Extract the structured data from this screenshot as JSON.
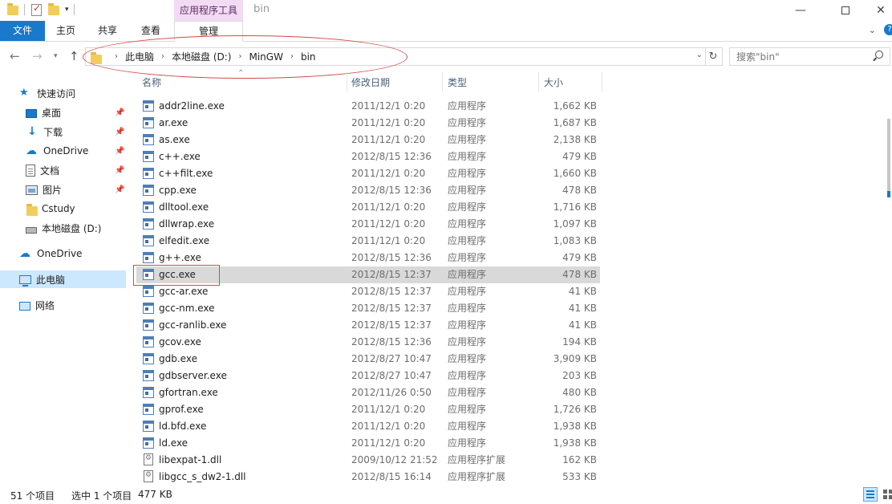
{
  "window": {
    "title": "bin",
    "context_tab_title": "应用程序工具"
  },
  "ribbon": {
    "tabs": [
      "文件",
      "主页",
      "共享",
      "查看",
      "管理"
    ]
  },
  "address": {
    "crumbs": [
      "此电脑",
      "本地磁盘 (D:)",
      "MinGW",
      "bin"
    ],
    "search_placeholder": "搜索\"bin\""
  },
  "sidebar": {
    "quick_access": "快速访问",
    "items": [
      {
        "label": "桌面",
        "icon": "desktop-icon",
        "pinned": true
      },
      {
        "label": "下载",
        "icon": "download-icon",
        "pinned": true
      },
      {
        "label": "OneDrive",
        "icon": "onedrive-icon",
        "pinned": true
      },
      {
        "label": "文档",
        "icon": "documents-icon",
        "pinned": true
      },
      {
        "label": "图片",
        "icon": "pictures-icon",
        "pinned": true
      },
      {
        "label": "Cstudy",
        "icon": "folder-icon",
        "pinned": false
      },
      {
        "label": "本地磁盘 (D:)",
        "icon": "drive-icon",
        "pinned": false
      }
    ],
    "onedrive": "OneDrive",
    "this_pc": "此电脑",
    "network": "网络"
  },
  "columns": {
    "name": "名称",
    "date": "修改日期",
    "type": "类型",
    "size": "大小"
  },
  "files": [
    {
      "name": "addr2line.exe",
      "date": "2011/12/1 0:20",
      "type": "应用程序",
      "size": "1,662 KB",
      "kind": "exe"
    },
    {
      "name": "ar.exe",
      "date": "2011/12/1 0:20",
      "type": "应用程序",
      "size": "1,687 KB",
      "kind": "exe"
    },
    {
      "name": "as.exe",
      "date": "2011/12/1 0:20",
      "type": "应用程序",
      "size": "2,138 KB",
      "kind": "exe"
    },
    {
      "name": "c++.exe",
      "date": "2012/8/15 12:36",
      "type": "应用程序",
      "size": "479 KB",
      "kind": "exe"
    },
    {
      "name": "c++filt.exe",
      "date": "2011/12/1 0:20",
      "type": "应用程序",
      "size": "1,660 KB",
      "kind": "exe"
    },
    {
      "name": "cpp.exe",
      "date": "2012/8/15 12:36",
      "type": "应用程序",
      "size": "478 KB",
      "kind": "exe"
    },
    {
      "name": "dlltool.exe",
      "date": "2011/12/1 0:20",
      "type": "应用程序",
      "size": "1,716 KB",
      "kind": "exe"
    },
    {
      "name": "dllwrap.exe",
      "date": "2011/12/1 0:20",
      "type": "应用程序",
      "size": "1,097 KB",
      "kind": "exe"
    },
    {
      "name": "elfedit.exe",
      "date": "2011/12/1 0:20",
      "type": "应用程序",
      "size": "1,083 KB",
      "kind": "exe"
    },
    {
      "name": "g++.exe",
      "date": "2012/8/15 12:36",
      "type": "应用程序",
      "size": "479 KB",
      "kind": "exe"
    },
    {
      "name": "gcc.exe",
      "date": "2012/8/15 12:37",
      "type": "应用程序",
      "size": "478 KB",
      "kind": "exe",
      "selected": true
    },
    {
      "name": "gcc-ar.exe",
      "date": "2012/8/15 12:37",
      "type": "应用程序",
      "size": "41 KB",
      "kind": "exe"
    },
    {
      "name": "gcc-nm.exe",
      "date": "2012/8/15 12:37",
      "type": "应用程序",
      "size": "41 KB",
      "kind": "exe"
    },
    {
      "name": "gcc-ranlib.exe",
      "date": "2012/8/15 12:37",
      "type": "应用程序",
      "size": "41 KB",
      "kind": "exe"
    },
    {
      "name": "gcov.exe",
      "date": "2012/8/15 12:36",
      "type": "应用程序",
      "size": "194 KB",
      "kind": "exe"
    },
    {
      "name": "gdb.exe",
      "date": "2012/8/27 10:47",
      "type": "应用程序",
      "size": "3,909 KB",
      "kind": "exe"
    },
    {
      "name": "gdbserver.exe",
      "date": "2012/8/27 10:47",
      "type": "应用程序",
      "size": "203 KB",
      "kind": "exe"
    },
    {
      "name": "gfortran.exe",
      "date": "2012/11/26 0:50",
      "type": "应用程序",
      "size": "480 KB",
      "kind": "exe"
    },
    {
      "name": "gprof.exe",
      "date": "2011/12/1 0:20",
      "type": "应用程序",
      "size": "1,726 KB",
      "kind": "exe"
    },
    {
      "name": "ld.bfd.exe",
      "date": "2011/12/1 0:20",
      "type": "应用程序",
      "size": "1,938 KB",
      "kind": "exe"
    },
    {
      "name": "ld.exe",
      "date": "2011/12/1 0:20",
      "type": "应用程序",
      "size": "1,938 KB",
      "kind": "exe"
    },
    {
      "name": "libexpat-1.dll",
      "date": "2009/10/12 21:52",
      "type": "应用程序扩展",
      "size": "162 KB",
      "kind": "dll"
    },
    {
      "name": "libgcc_s_dw2-1.dll",
      "date": "2012/8/15 16:14",
      "type": "应用程序扩展",
      "size": "533 KB",
      "kind": "dll"
    }
  ],
  "status": {
    "item_count": "51 个项目",
    "selected": "选中 1 个项目",
    "selected_size": "477 KB"
  },
  "colors": {
    "accent": "#1979ca",
    "context_tab": "#f4dbf4",
    "annotation": "#d24a4a"
  }
}
